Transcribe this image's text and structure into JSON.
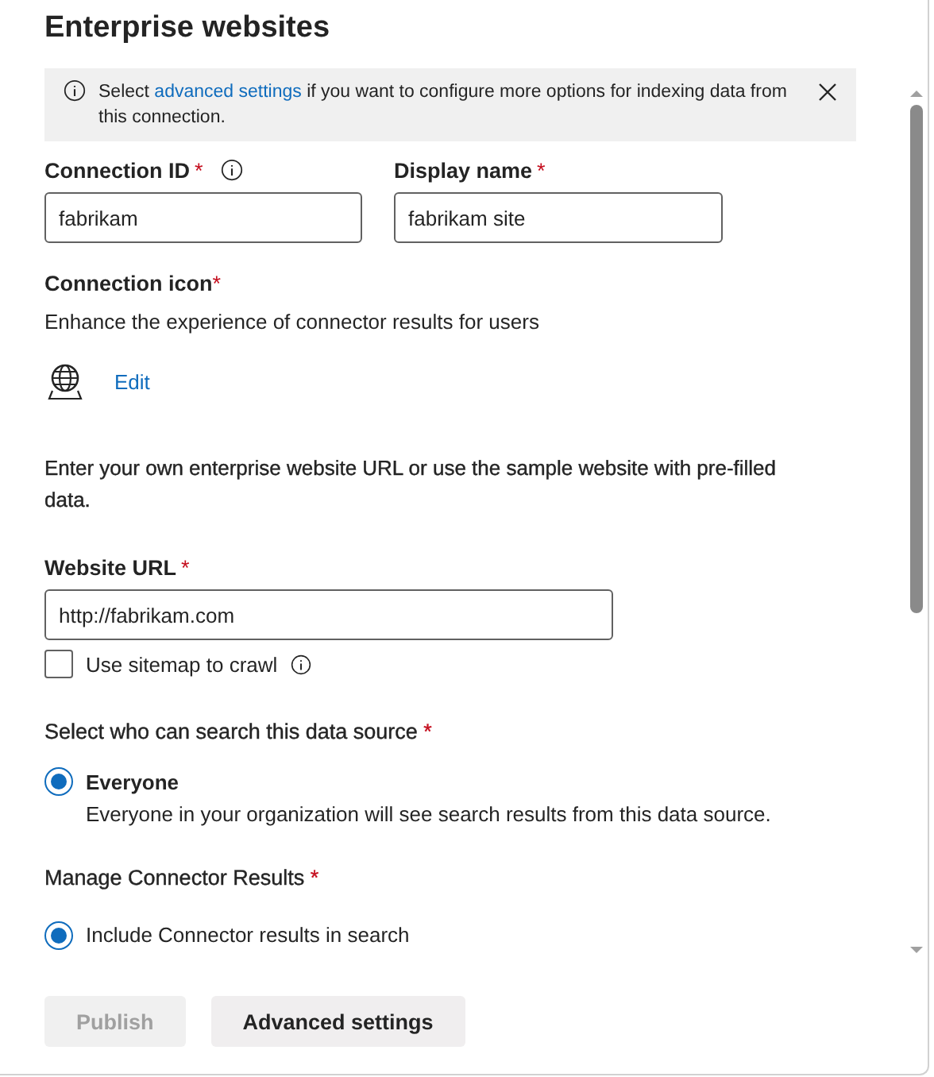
{
  "title": "Enterprise websites",
  "banner": {
    "text_before": "Select",
    "link": "advanced settings",
    "text_after": "if you want to configure more options for indexing data from this connection.",
    "dismissible": true
  },
  "fields": [
    {
      "label": "Connection ID",
      "asterisk": "*",
      "info": true,
      "value": "fabrikam"
    },
    {
      "label": "Display name",
      "asterisk": "*",
      "info": false,
      "value": "fabrikam site"
    }
  ],
  "connection_icon": {
    "label": "Connection icon",
    "asterisk": "*",
    "description": "Enhance the experience of connector results for users",
    "edit_link": "Edit"
  },
  "url_intro": "Enter your own enterprise website URL or use the sample website with pre-filled data.",
  "website_url": {
    "label": "Website URL",
    "asterisk": "*",
    "value": "http://fabrikam.com"
  },
  "sitemap": {
    "label": "Use sitemap to crawl",
    "checked": false,
    "info": true
  },
  "search_access": {
    "label": "Select who can search this data source",
    "asterisk": "*",
    "options": [
      {
        "label": "Everyone",
        "description": "Everyone in your organization will see search results from this data source.",
        "selected": true
      }
    ]
  },
  "connector_results": {
    "label": "Manage Connector Results",
    "asterisk": "*",
    "options": [
      {
        "label": "Include Connector results in search",
        "selected": true
      }
    ]
  },
  "buttons": [
    {
      "label": "Publish",
      "kind": "primary",
      "disabled": true
    },
    {
      "label": "Advanced settings",
      "kind": "secondary",
      "disabled": false
    }
  ]
}
